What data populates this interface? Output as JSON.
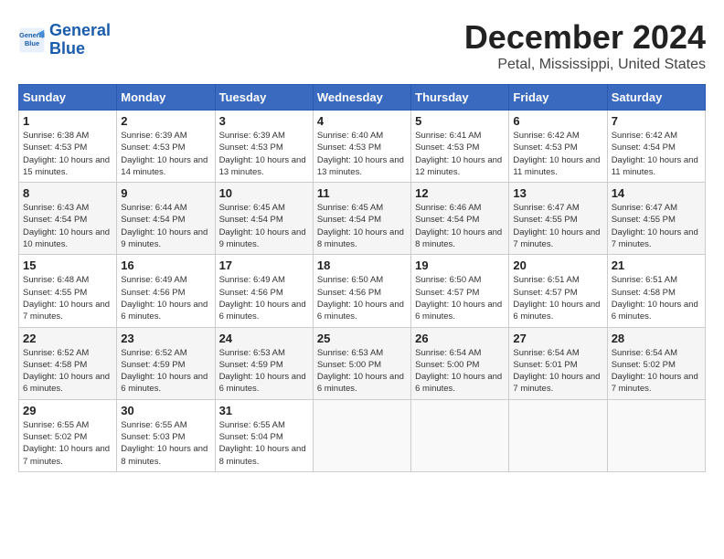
{
  "header": {
    "title": "December 2024",
    "subtitle": "Petal, Mississippi, United States",
    "logo_line1": "General",
    "logo_line2": "Blue"
  },
  "columns": [
    "Sunday",
    "Monday",
    "Tuesday",
    "Wednesday",
    "Thursday",
    "Friday",
    "Saturday"
  ],
  "weeks": [
    [
      {
        "day": "1",
        "sunrise": "6:38 AM",
        "sunset": "4:53 PM",
        "daylight": "10 hours and 15 minutes."
      },
      {
        "day": "2",
        "sunrise": "6:39 AM",
        "sunset": "4:53 PM",
        "daylight": "10 hours and 14 minutes."
      },
      {
        "day": "3",
        "sunrise": "6:39 AM",
        "sunset": "4:53 PM",
        "daylight": "10 hours and 13 minutes."
      },
      {
        "day": "4",
        "sunrise": "6:40 AM",
        "sunset": "4:53 PM",
        "daylight": "10 hours and 13 minutes."
      },
      {
        "day": "5",
        "sunrise": "6:41 AM",
        "sunset": "4:53 PM",
        "daylight": "10 hours and 12 minutes."
      },
      {
        "day": "6",
        "sunrise": "6:42 AM",
        "sunset": "4:53 PM",
        "daylight": "10 hours and 11 minutes."
      },
      {
        "day": "7",
        "sunrise": "6:42 AM",
        "sunset": "4:54 PM",
        "daylight": "10 hours and 11 minutes."
      }
    ],
    [
      {
        "day": "8",
        "sunrise": "6:43 AM",
        "sunset": "4:54 PM",
        "daylight": "10 hours and 10 minutes."
      },
      {
        "day": "9",
        "sunrise": "6:44 AM",
        "sunset": "4:54 PM",
        "daylight": "10 hours and 9 minutes."
      },
      {
        "day": "10",
        "sunrise": "6:45 AM",
        "sunset": "4:54 PM",
        "daylight": "10 hours and 9 minutes."
      },
      {
        "day": "11",
        "sunrise": "6:45 AM",
        "sunset": "4:54 PM",
        "daylight": "10 hours and 8 minutes."
      },
      {
        "day": "12",
        "sunrise": "6:46 AM",
        "sunset": "4:54 PM",
        "daylight": "10 hours and 8 minutes."
      },
      {
        "day": "13",
        "sunrise": "6:47 AM",
        "sunset": "4:55 PM",
        "daylight": "10 hours and 7 minutes."
      },
      {
        "day": "14",
        "sunrise": "6:47 AM",
        "sunset": "4:55 PM",
        "daylight": "10 hours and 7 minutes."
      }
    ],
    [
      {
        "day": "15",
        "sunrise": "6:48 AM",
        "sunset": "4:55 PM",
        "daylight": "10 hours and 7 minutes."
      },
      {
        "day": "16",
        "sunrise": "6:49 AM",
        "sunset": "4:56 PM",
        "daylight": "10 hours and 6 minutes."
      },
      {
        "day": "17",
        "sunrise": "6:49 AM",
        "sunset": "4:56 PM",
        "daylight": "10 hours and 6 minutes."
      },
      {
        "day": "18",
        "sunrise": "6:50 AM",
        "sunset": "4:56 PM",
        "daylight": "10 hours and 6 minutes."
      },
      {
        "day": "19",
        "sunrise": "6:50 AM",
        "sunset": "4:57 PM",
        "daylight": "10 hours and 6 minutes."
      },
      {
        "day": "20",
        "sunrise": "6:51 AM",
        "sunset": "4:57 PM",
        "daylight": "10 hours and 6 minutes."
      },
      {
        "day": "21",
        "sunrise": "6:51 AM",
        "sunset": "4:58 PM",
        "daylight": "10 hours and 6 minutes."
      }
    ],
    [
      {
        "day": "22",
        "sunrise": "6:52 AM",
        "sunset": "4:58 PM",
        "daylight": "10 hours and 6 minutes."
      },
      {
        "day": "23",
        "sunrise": "6:52 AM",
        "sunset": "4:59 PM",
        "daylight": "10 hours and 6 minutes."
      },
      {
        "day": "24",
        "sunrise": "6:53 AM",
        "sunset": "4:59 PM",
        "daylight": "10 hours and 6 minutes."
      },
      {
        "day": "25",
        "sunrise": "6:53 AM",
        "sunset": "5:00 PM",
        "daylight": "10 hours and 6 minutes."
      },
      {
        "day": "26",
        "sunrise": "6:54 AM",
        "sunset": "5:00 PM",
        "daylight": "10 hours and 6 minutes."
      },
      {
        "day": "27",
        "sunrise": "6:54 AM",
        "sunset": "5:01 PM",
        "daylight": "10 hours and 7 minutes."
      },
      {
        "day": "28",
        "sunrise": "6:54 AM",
        "sunset": "5:02 PM",
        "daylight": "10 hours and 7 minutes."
      }
    ],
    [
      {
        "day": "29",
        "sunrise": "6:55 AM",
        "sunset": "5:02 PM",
        "daylight": "10 hours and 7 minutes."
      },
      {
        "day": "30",
        "sunrise": "6:55 AM",
        "sunset": "5:03 PM",
        "daylight": "10 hours and 8 minutes."
      },
      {
        "day": "31",
        "sunrise": "6:55 AM",
        "sunset": "5:04 PM",
        "daylight": "10 hours and 8 minutes."
      },
      null,
      null,
      null,
      null
    ]
  ]
}
